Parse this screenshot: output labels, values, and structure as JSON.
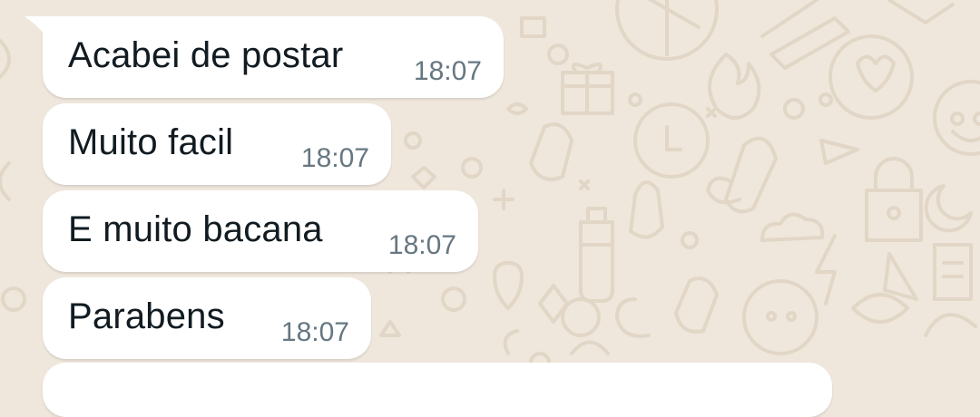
{
  "colors": {
    "wallpaper": "#efe7dc",
    "doodle": "#e2d6c6",
    "bubble": "#ffffff",
    "text": "#111b21",
    "timestamp": "#667781"
  },
  "messages": [
    {
      "text": "Acabei de postar",
      "time": "18:07"
    },
    {
      "text": "Muito facil",
      "time": "18:07"
    },
    {
      "text": "E muito bacana",
      "time": "18:07"
    },
    {
      "text": "Parabens",
      "time": "18:07"
    }
  ]
}
